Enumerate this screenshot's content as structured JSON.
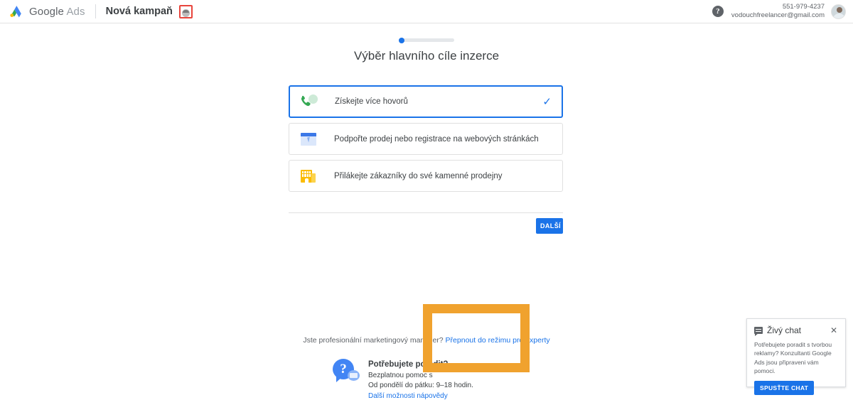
{
  "topbar": {
    "brand_primary": "Google",
    "brand_secondary": "Ads",
    "campaign_title": "Nová kampaň",
    "campaign_badge_icon": "campaign-thumbnail-icon",
    "help_icon": "help-icon",
    "account_phone": "551-979-4237",
    "account_email": "vodouchfreelancer@gmail.com",
    "avatar_icon": "user-avatar"
  },
  "stepper": {
    "progress_percent": 10,
    "dot_color": "#1a73e8",
    "track_color": "#e4e7ea"
  },
  "page": {
    "title": "Výběr hlavního cíle inzerce"
  },
  "goals": [
    {
      "label": "Získejte více hovorů",
      "icon": "phone-icon",
      "selected": true,
      "check_icon": "check-icon"
    },
    {
      "label": "Podpořte prodej nebo registrace na webových stránkách",
      "icon": "browser-window-icon",
      "selected": false,
      "check_icon": ""
    },
    {
      "label": "Přilákejte zákazníky do své kamenné prodejny",
      "icon": "storefront-icon",
      "selected": false,
      "check_icon": ""
    }
  ],
  "actions": {
    "next_label": "DALŠÍ",
    "next_color": "#1a73e8"
  },
  "expert": {
    "question": "Jste profesionální marketingový manažer?",
    "link_label": "Přepnout do režimu pro experty",
    "link_color": "#1a73e8"
  },
  "help": {
    "icon": "help-chat-icon",
    "title": "Potřebujete poradit?",
    "line1": "Bezplatnou pomoc s",
    "line2": "Od pondělí do pátku: 9–18 hodin.",
    "more_label": "Další možnosti nápovědy"
  },
  "annotation": {
    "type": "highlight-rectangle",
    "color": "#f0a22e"
  },
  "chat": {
    "icon": "chat-bubble-icon",
    "title": "Živý chat",
    "close_icon": "close-icon",
    "close_glyph": "✕",
    "body": "Potřebujete poradit s tvorbou reklamy? Konzultanti Google Ads jsou připraveni vám pomoci.",
    "button_label": "SPUSŤTE CHAT",
    "button_color": "#1a73e8"
  }
}
